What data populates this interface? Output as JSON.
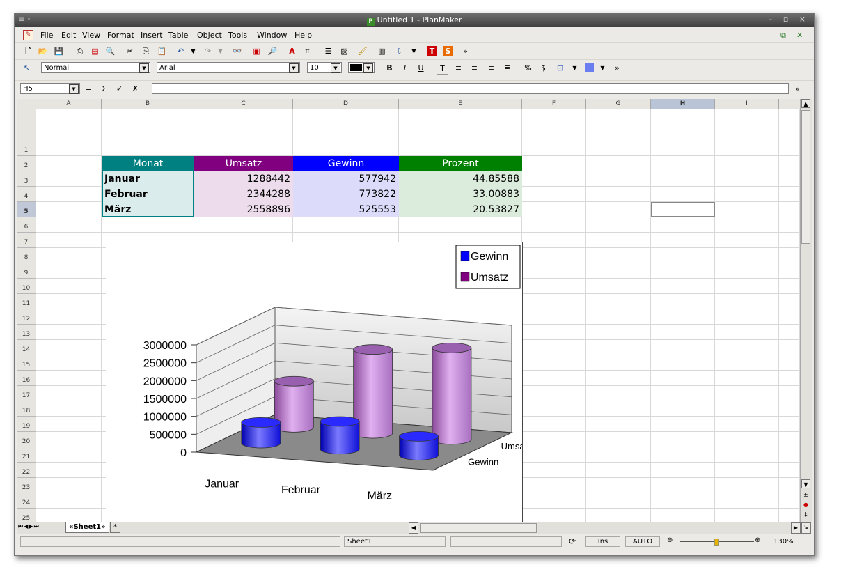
{
  "window": {
    "title": "Untitled 1 - PlanMaker"
  },
  "menu": {
    "items": [
      "File",
      "Edit",
      "View",
      "Format",
      "Insert",
      "Table",
      "Object",
      "Tools",
      "Window",
      "Help"
    ]
  },
  "format_toolbar": {
    "style": "Normal",
    "font": "Arial",
    "size": "10"
  },
  "edit_bar": {
    "cell_ref": "H5",
    "formula": ""
  },
  "columns": [
    "A",
    "B",
    "C",
    "D",
    "E",
    "F",
    "G",
    "H",
    "I"
  ],
  "rows": [
    "1",
    "2",
    "3",
    "4",
    "5",
    "6",
    "7",
    "8",
    "9",
    "10",
    "11",
    "12",
    "13",
    "14",
    "15",
    "16",
    "17",
    "18",
    "19",
    "20",
    "21",
    "22",
    "23",
    "24",
    "25"
  ],
  "active_cell": {
    "column": "H",
    "row": "5"
  },
  "table": {
    "headers": [
      "Monat",
      "Umsatz",
      "Gewinn",
      "Prozent"
    ],
    "header_colors": [
      "#008080",
      "#800080",
      "#0000ff",
      "#008000"
    ],
    "rows": [
      [
        "Januar",
        "1288442",
        "577942",
        "44.85588"
      ],
      [
        "Februar",
        "2344288",
        "773822",
        "33.00883"
      ],
      [
        "März",
        "2558896",
        "525553",
        "20.53827"
      ]
    ]
  },
  "chart_data": {
    "type": "bar",
    "subtype": "3d-cylinder",
    "categories": [
      "Januar",
      "Februar",
      "März"
    ],
    "series": [
      {
        "name": "Gewinn",
        "values": [
          577942,
          773822,
          525553
        ],
        "color": "#0000ff"
      },
      {
        "name": "Umsatz",
        "values": [
          1288442,
          2344288,
          2558896
        ],
        "color": "#800080"
      }
    ],
    "depth_labels": [
      "Gewinn",
      "Umsatz"
    ],
    "yticks": [
      "0",
      "500000",
      "1000000",
      "1500000",
      "2000000",
      "2500000",
      "3000000"
    ],
    "ylim": [
      0,
      3000000
    ],
    "grid": true,
    "legend": "top-right"
  },
  "tabs": {
    "sheets": [
      "Sheet1"
    ],
    "new_tab": "*"
  },
  "status": {
    "sheet": "Sheet1",
    "mode": "Ins",
    "calc": "AUTO",
    "zoom": "130%"
  }
}
